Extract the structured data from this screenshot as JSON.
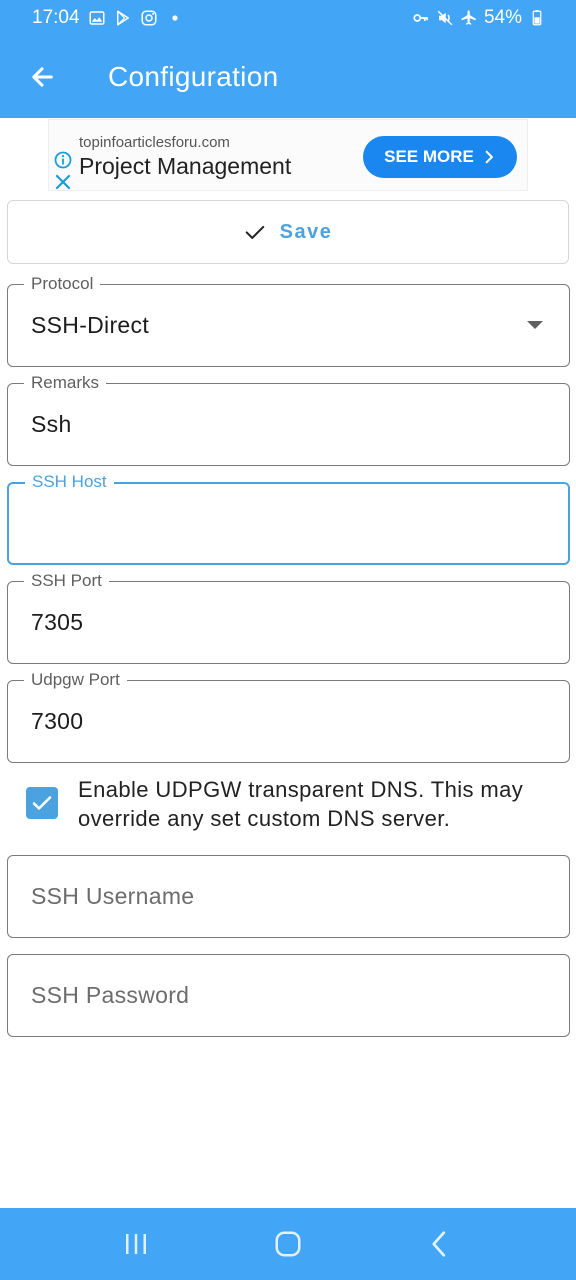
{
  "status_bar": {
    "time": "17:04",
    "battery": "54%",
    "left_icons": [
      "gallery-icon",
      "play-store-icon",
      "instagram-icon",
      "dot-icon"
    ],
    "right_icons": [
      "vpn-key-icon",
      "mute-icon",
      "airplane-icon",
      "battery-icon"
    ]
  },
  "app_bar": {
    "title": "Configuration",
    "back_icon": "arrow-back-icon"
  },
  "ad": {
    "url": "topinfoarticlesforu.com",
    "headline": "Project Management",
    "cta": "SEE MORE"
  },
  "toolbar": {
    "save_label": "Save"
  },
  "form": {
    "protocol": {
      "label": "Protocol",
      "value": "SSH-Direct"
    },
    "remarks": {
      "label": "Remarks",
      "value": "Ssh"
    },
    "ssh_host": {
      "label": "SSH Host",
      "value": ""
    },
    "ssh_port": {
      "label": "SSH Port",
      "value": "7305"
    },
    "udpgw_port": {
      "label": "Udpgw Port",
      "value": "7300"
    },
    "udpgw_dns": {
      "label": "Enable UDPGW transparent DNS. This may override any set custom DNS server.",
      "checked": true
    },
    "ssh_username": {
      "placeholder": "SSH Username",
      "value": ""
    },
    "ssh_password": {
      "placeholder": "SSH Password",
      "value": ""
    }
  },
  "colors": {
    "primary": "#42a5f5",
    "accent": "#4aa3df",
    "ad_cta": "#1a86f0"
  },
  "nav_bar": {
    "buttons": [
      "recents-icon",
      "home-icon",
      "back-icon"
    ]
  }
}
